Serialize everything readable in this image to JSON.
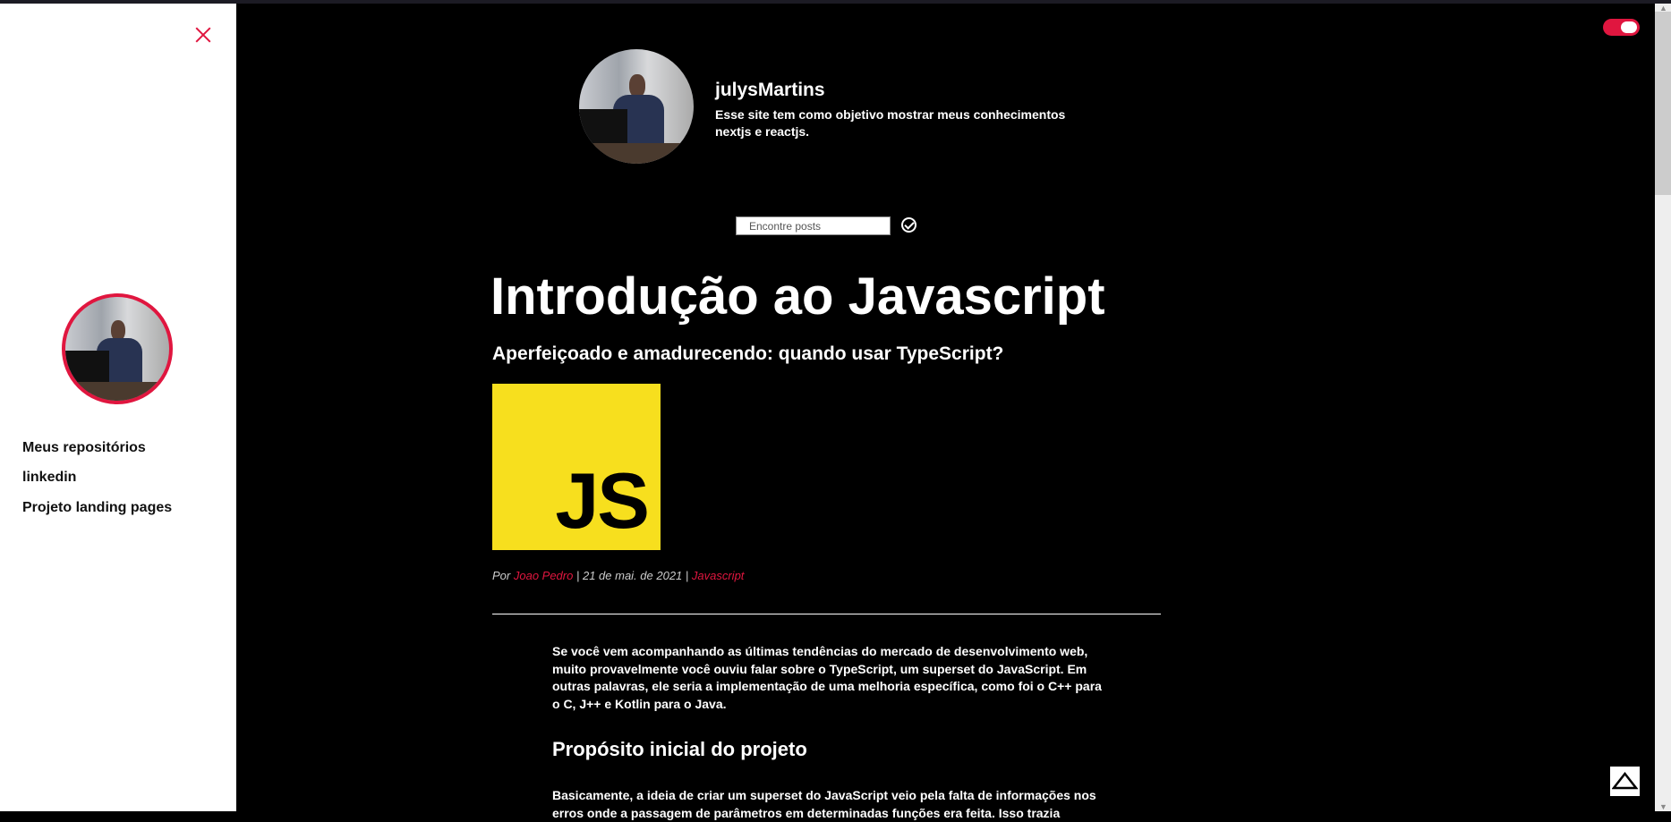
{
  "sidebar": {
    "links": [
      "Meus repositórios",
      "linkedin",
      "Projeto landing pages"
    ]
  },
  "header": {
    "name": "julysMartins",
    "description": "Esse site tem como objetivo mostrar meus conhecimentos nextjs e reactjs."
  },
  "search": {
    "placeholder": "Encontre posts",
    "value": ""
  },
  "post": {
    "title": "Introdução ao Javascript",
    "subtitle": "Aperfeiçoado e amadurecendo: quando usar TypeScript?",
    "image_text": "JS",
    "meta": {
      "by": "Por",
      "author": "Joao Pedro",
      "sep1": " | ",
      "date": "21 de mai. de 2021",
      "sep2": " | ",
      "category": "Javascript"
    },
    "paragraph1": "Se você vem acompanhando as últimas tendências do mercado de desenvolvimento web, muito provavelmente você ouviu falar sobre o TypeScript, um superset do JavaScript. Em outras palavras, ele seria a implementação de uma melhoria específica, como foi o C++ para o C, J++ e Kotlin para o Java.",
    "heading2": "Propósito inicial do projeto",
    "paragraph2": "Basicamente, a ideia de criar um superset do JavaScript veio pela falta de informações nos erros onde a passagem de parâmetros em determinadas funções era feita. Isso trazia"
  },
  "colors": {
    "accent": "#e0163f",
    "background": "#000000",
    "js_yellow": "#f7df1e"
  }
}
